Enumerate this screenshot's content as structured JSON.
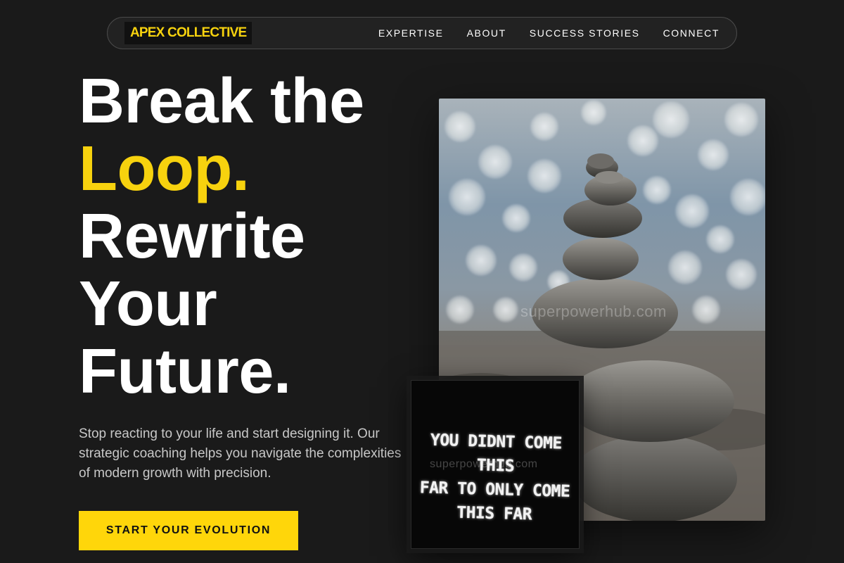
{
  "nav": {
    "brand": "APEX COLLECTIVE",
    "links": [
      "EXPERTISE",
      "ABOUT",
      "SUCCESS STORIES",
      "CONNECT"
    ]
  },
  "hero": {
    "headline": {
      "line1": "Break the",
      "line2": "Loop.",
      "line3": "Rewrite",
      "line4": "Your",
      "line5": "Future."
    },
    "subtext": "Stop reacting to your life and start designing it. Our strategic coaching helps you navigate the complexities of modern growth with precision.",
    "cta_label": "START YOUR EVOLUTION"
  },
  "images": {
    "main_photo": {
      "watermark": "superpowerhub.com"
    },
    "quote_card": {
      "line1": "YOU DIDNT COME THIS",
      "line2": "FAR TO ONLY COME",
      "line3": "THIS FAR",
      "watermark": "superpowerhub.com"
    }
  },
  "colors": {
    "background": "#1a1a1a",
    "accent": "#f7d20e",
    "cta": "#ffd60a",
    "text": "#ffffff",
    "muted": "#c8c8c8"
  }
}
